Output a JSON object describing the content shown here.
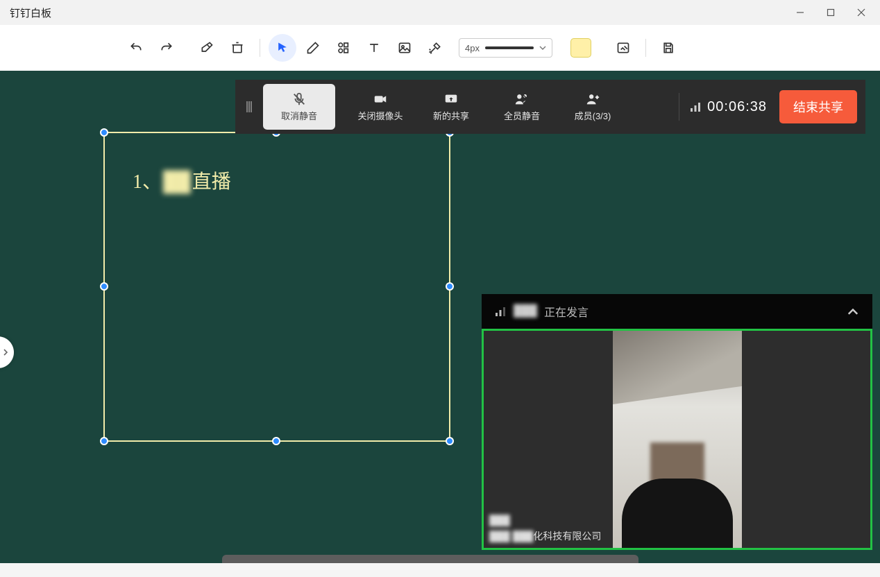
{
  "window": {
    "title": "钉钉白板"
  },
  "toolbar": {
    "stroke_label": "4px",
    "icons": {
      "undo": "undo-icon",
      "redo": "redo-icon",
      "eraser": "eraser-icon",
      "clear": "clear-icon",
      "select": "cursor-icon",
      "pen": "pen-icon",
      "shapes": "shapes-icon",
      "text": "text-icon",
      "image": "image-icon",
      "laser": "laser-icon",
      "edit_bg": "edit-background-icon",
      "save": "save-icon"
    },
    "color": "#fff0a8"
  },
  "meeting": {
    "unmute": "取消静音",
    "camera_off": "关闭摄像头",
    "new_share": "新的共享",
    "mute_all": "全员静音",
    "members": "成员(3/3)",
    "timer": "00:06:38",
    "end_share": "结束共享"
  },
  "canvas": {
    "text_prefix": "1、",
    "text_blur": "██",
    "text_suffix": "直播"
  },
  "video_panel": {
    "header_blur": "███",
    "header_suffix": "正在发言",
    "name_blur": "███",
    "company_prefix_blur": "███ ███",
    "company_suffix": "化科技有限公司"
  }
}
